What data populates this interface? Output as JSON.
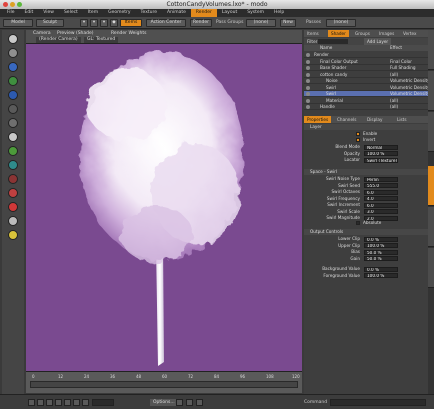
{
  "window": {
    "title": "CottonCandyVolumes.lxo* - modo"
  },
  "menu": [
    "File",
    "Edit",
    "View",
    "Select",
    "Item",
    "Geometry",
    "Texture",
    "Animate",
    "Render",
    "Layout",
    "System",
    "Help"
  ],
  "toolbar": {
    "mode_label": "Model",
    "sculpt_label": "Sculpt",
    "items_label": "Items",
    "action_center_label": "Action Center",
    "render_label": "Render",
    "pass_groups_label": "Pass Groups",
    "pass_groups_value": "(none)",
    "new_label": "New",
    "passes_label": "Passes",
    "passes_value": "(none)"
  },
  "viewport": {
    "tabs": [
      "Camera",
      "Preview (Shade)",
      "Render Weights"
    ],
    "sub_tabs": [
      "(Render Camera)",
      "GL: Textured"
    ],
    "bg_color": "#7a4a90"
  },
  "timeline": {
    "ticks": [
      "0",
      "12",
      "24",
      "36",
      "48",
      "60",
      "72",
      "84",
      "96",
      "108",
      "120"
    ]
  },
  "bottom": {
    "options_label": "Options...",
    "command_label": "Command"
  },
  "shader_tree": {
    "tabs": [
      "Items",
      "Shader",
      "Groups",
      "Images",
      "Vertex"
    ],
    "filter_label": "Filter",
    "add_layer_label": "Add Layer",
    "col_name": "Name",
    "col_effect": "Effect",
    "rows": [
      {
        "name": "Render",
        "effect": ""
      },
      {
        "name": "Final Color Output",
        "effect": "Final Color"
      },
      {
        "name": "Base Shader",
        "effect": "Full Shading"
      },
      {
        "name": "cotton candy",
        "effect": "(all)"
      },
      {
        "name": "Noise",
        "effect": "Volumetric Density"
      },
      {
        "name": "Swirl",
        "effect": "Volumetric Density"
      },
      {
        "name": "Swirl",
        "effect": "Volumetric Density"
      },
      {
        "name": "Material",
        "effect": "(all)"
      },
      {
        "name": "Handle",
        "effect": "(all)"
      }
    ]
  },
  "properties": {
    "tabs": [
      "Properties",
      "Channels",
      "Display",
      "Lists"
    ],
    "layer_section": "Layer",
    "enable_label": "Enable",
    "invert_label": "Invert",
    "layer_rows": [
      {
        "label": "Blend Mode",
        "value": "Normal"
      },
      {
        "label": "Opacity",
        "value": "100.0 %"
      },
      {
        "label": "Locator",
        "value": "Swirl (Texture) (5)"
      }
    ],
    "swirl_section": "Space - Swirl",
    "swirl_rows": [
      {
        "label": "Swirl Noise Type",
        "value": "Perlin"
      },
      {
        "label": "Swirl Seed",
        "value": "555.0"
      },
      {
        "label": "Swirl Octaves",
        "value": "6.0"
      },
      {
        "label": "Swirl Frequency",
        "value": "4.0"
      },
      {
        "label": "Swirl Increment",
        "value": "6.0"
      },
      {
        "label": "Swirl Scale",
        "value": "3.0"
      },
      {
        "label": "Swirl Magnitude",
        "value": "2.0"
      }
    ],
    "absolute_label": "Absolute",
    "output_section": "Output Controls",
    "output_rows": [
      {
        "label": "Lower Clip",
        "value": "0.0 %"
      },
      {
        "label": "Upper Clip",
        "value": "100.0 %"
      },
      {
        "label": "Bias",
        "value": "50.0 %"
      },
      {
        "label": "Gain",
        "value": "50.0 %"
      }
    ],
    "value_rows": [
      {
        "label": "Background Value",
        "value": "0.0 %"
      },
      {
        "label": "Foreground Value",
        "value": "100.0 %"
      }
    ]
  }
}
